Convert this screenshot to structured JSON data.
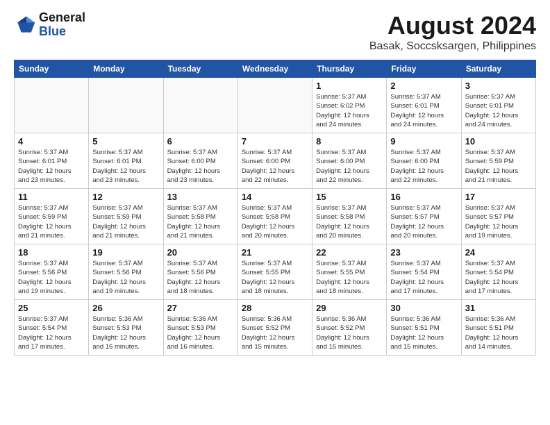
{
  "logo": {
    "line1": "General",
    "line2": "Blue"
  },
  "title": "August 2024",
  "subtitle": "Basak, Soccsksargen, Philippines",
  "days_of_week": [
    "Sunday",
    "Monday",
    "Tuesday",
    "Wednesday",
    "Thursday",
    "Friday",
    "Saturday"
  ],
  "weeks": [
    [
      {
        "num": "",
        "info": "",
        "empty": true
      },
      {
        "num": "",
        "info": "",
        "empty": true
      },
      {
        "num": "",
        "info": "",
        "empty": true
      },
      {
        "num": "",
        "info": "",
        "empty": true
      },
      {
        "num": "1",
        "info": "Sunrise: 5:37 AM\nSunset: 6:02 PM\nDaylight: 12 hours\nand 24 minutes.",
        "empty": false
      },
      {
        "num": "2",
        "info": "Sunrise: 5:37 AM\nSunset: 6:01 PM\nDaylight: 12 hours\nand 24 minutes.",
        "empty": false
      },
      {
        "num": "3",
        "info": "Sunrise: 5:37 AM\nSunset: 6:01 PM\nDaylight: 12 hours\nand 24 minutes.",
        "empty": false
      }
    ],
    [
      {
        "num": "4",
        "info": "Sunrise: 5:37 AM\nSunset: 6:01 PM\nDaylight: 12 hours\nand 23 minutes.",
        "empty": false
      },
      {
        "num": "5",
        "info": "Sunrise: 5:37 AM\nSunset: 6:01 PM\nDaylight: 12 hours\nand 23 minutes.",
        "empty": false
      },
      {
        "num": "6",
        "info": "Sunrise: 5:37 AM\nSunset: 6:00 PM\nDaylight: 12 hours\nand 23 minutes.",
        "empty": false
      },
      {
        "num": "7",
        "info": "Sunrise: 5:37 AM\nSunset: 6:00 PM\nDaylight: 12 hours\nand 22 minutes.",
        "empty": false
      },
      {
        "num": "8",
        "info": "Sunrise: 5:37 AM\nSunset: 6:00 PM\nDaylight: 12 hours\nand 22 minutes.",
        "empty": false
      },
      {
        "num": "9",
        "info": "Sunrise: 5:37 AM\nSunset: 6:00 PM\nDaylight: 12 hours\nand 22 minutes.",
        "empty": false
      },
      {
        "num": "10",
        "info": "Sunrise: 5:37 AM\nSunset: 5:59 PM\nDaylight: 12 hours\nand 21 minutes.",
        "empty": false
      }
    ],
    [
      {
        "num": "11",
        "info": "Sunrise: 5:37 AM\nSunset: 5:59 PM\nDaylight: 12 hours\nand 21 minutes.",
        "empty": false
      },
      {
        "num": "12",
        "info": "Sunrise: 5:37 AM\nSunset: 5:59 PM\nDaylight: 12 hours\nand 21 minutes.",
        "empty": false
      },
      {
        "num": "13",
        "info": "Sunrise: 5:37 AM\nSunset: 5:58 PM\nDaylight: 12 hours\nand 21 minutes.",
        "empty": false
      },
      {
        "num": "14",
        "info": "Sunrise: 5:37 AM\nSunset: 5:58 PM\nDaylight: 12 hours\nand 20 minutes.",
        "empty": false
      },
      {
        "num": "15",
        "info": "Sunrise: 5:37 AM\nSunset: 5:58 PM\nDaylight: 12 hours\nand 20 minutes.",
        "empty": false
      },
      {
        "num": "16",
        "info": "Sunrise: 5:37 AM\nSunset: 5:57 PM\nDaylight: 12 hours\nand 20 minutes.",
        "empty": false
      },
      {
        "num": "17",
        "info": "Sunrise: 5:37 AM\nSunset: 5:57 PM\nDaylight: 12 hours\nand 19 minutes.",
        "empty": false
      }
    ],
    [
      {
        "num": "18",
        "info": "Sunrise: 5:37 AM\nSunset: 5:56 PM\nDaylight: 12 hours\nand 19 minutes.",
        "empty": false
      },
      {
        "num": "19",
        "info": "Sunrise: 5:37 AM\nSunset: 5:56 PM\nDaylight: 12 hours\nand 19 minutes.",
        "empty": false
      },
      {
        "num": "20",
        "info": "Sunrise: 5:37 AM\nSunset: 5:56 PM\nDaylight: 12 hours\nand 18 minutes.",
        "empty": false
      },
      {
        "num": "21",
        "info": "Sunrise: 5:37 AM\nSunset: 5:55 PM\nDaylight: 12 hours\nand 18 minutes.",
        "empty": false
      },
      {
        "num": "22",
        "info": "Sunrise: 5:37 AM\nSunset: 5:55 PM\nDaylight: 12 hours\nand 18 minutes.",
        "empty": false
      },
      {
        "num": "23",
        "info": "Sunrise: 5:37 AM\nSunset: 5:54 PM\nDaylight: 12 hours\nand 17 minutes.",
        "empty": false
      },
      {
        "num": "24",
        "info": "Sunrise: 5:37 AM\nSunset: 5:54 PM\nDaylight: 12 hours\nand 17 minutes.",
        "empty": false
      }
    ],
    [
      {
        "num": "25",
        "info": "Sunrise: 5:37 AM\nSunset: 5:54 PM\nDaylight: 12 hours\nand 17 minutes.",
        "empty": false
      },
      {
        "num": "26",
        "info": "Sunrise: 5:36 AM\nSunset: 5:53 PM\nDaylight: 12 hours\nand 16 minutes.",
        "empty": false
      },
      {
        "num": "27",
        "info": "Sunrise: 5:36 AM\nSunset: 5:53 PM\nDaylight: 12 hours\nand 16 minutes.",
        "empty": false
      },
      {
        "num": "28",
        "info": "Sunrise: 5:36 AM\nSunset: 5:52 PM\nDaylight: 12 hours\nand 15 minutes.",
        "empty": false
      },
      {
        "num": "29",
        "info": "Sunrise: 5:36 AM\nSunset: 5:52 PM\nDaylight: 12 hours\nand 15 minutes.",
        "empty": false
      },
      {
        "num": "30",
        "info": "Sunrise: 5:36 AM\nSunset: 5:51 PM\nDaylight: 12 hours\nand 15 minutes.",
        "empty": false
      },
      {
        "num": "31",
        "info": "Sunrise: 5:36 AM\nSunset: 5:51 PM\nDaylight: 12 hours\nand 14 minutes.",
        "empty": false
      }
    ]
  ]
}
